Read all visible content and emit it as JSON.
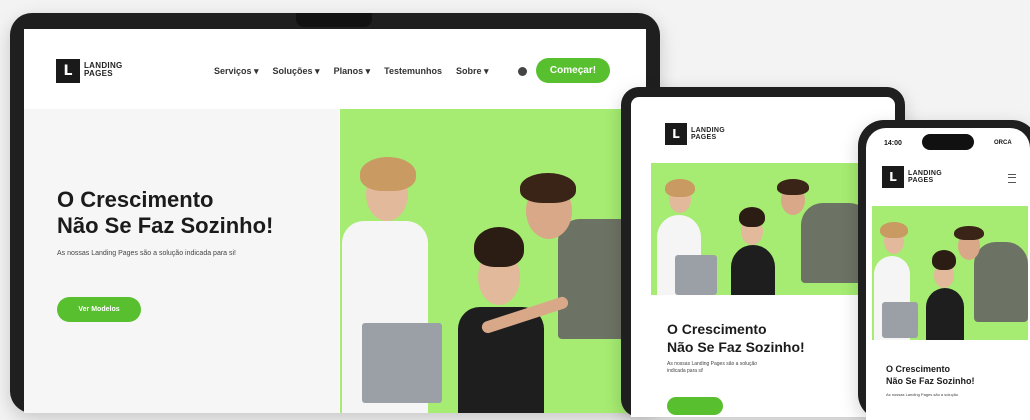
{
  "desktop": {
    "logo": {
      "mark": "L",
      "line1": "LANDING",
      "line2": "PAGES"
    },
    "nav": [
      {
        "label": "Serviços ▾"
      },
      {
        "label": "Soluções ▾"
      },
      {
        "label": "Planos ▾"
      },
      {
        "label": "Testemunhos"
      },
      {
        "label": "Sobre ▾"
      }
    ],
    "cta": "Começar!",
    "hero": {
      "title1": "O Crescimento",
      "title2": "Não Se Faz Sozinho!",
      "subtitle": "As nossas Landing Pages são a solução indicada para si!",
      "button": "Ver Modelos"
    }
  },
  "tablet": {
    "logo": {
      "mark": "L",
      "line1": "LANDING",
      "line2": "PAGES"
    },
    "hero": {
      "title1": "O Crescimento",
      "title2": "Não Se Faz Sozinho!",
      "subtitle": "As nossas Landing Pages são a solução indicada para si!"
    }
  },
  "phone": {
    "time": "14:00",
    "status": "ORCA",
    "logo": {
      "mark": "L",
      "line1": "LANDING",
      "line2": "PAGES"
    },
    "menu_icon": "hamburger-icon",
    "hero": {
      "title1": "O Crescimento",
      "title2": "Não Se Faz Sozinho!",
      "subtitle": "As nossas Landing Pages são a solução"
    }
  },
  "colors": {
    "accent": "#58c02f",
    "photo_bg": "#a6ec72",
    "frame": "#1f1f1f",
    "background": "#f3f3f3"
  }
}
